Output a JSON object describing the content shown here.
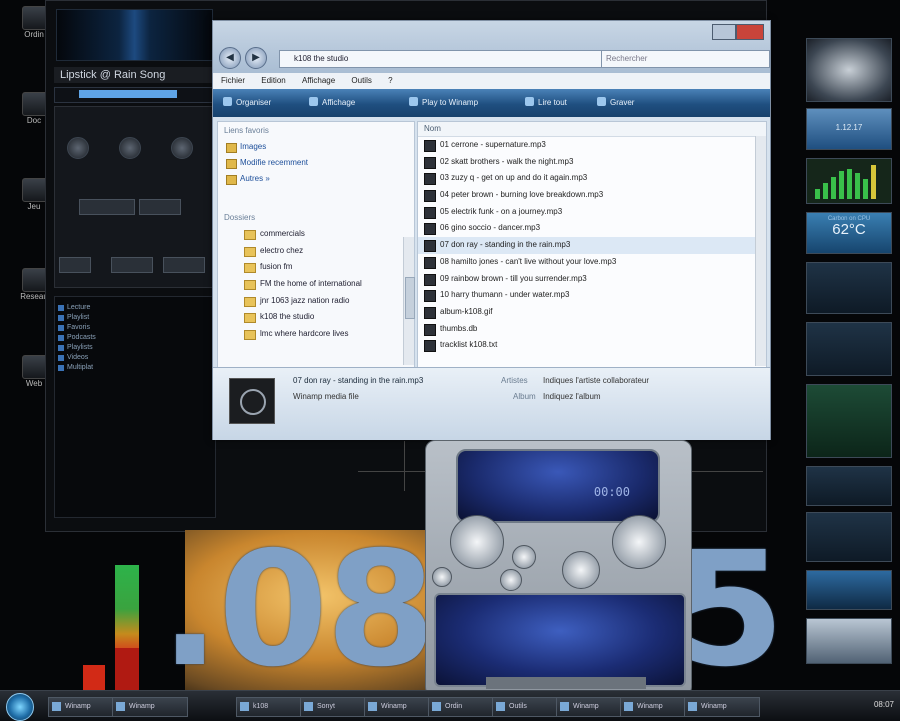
{
  "desktop": {
    "icons": [
      {
        "label": "Ordin"
      },
      {
        "label": "Doc"
      },
      {
        "label": "Jeu"
      },
      {
        "label": "Reseau"
      },
      {
        "label": "Web"
      }
    ]
  },
  "winamp": {
    "title": "Lipstick @ Rain Song",
    "seek_progress": 0.75,
    "tree_items": [
      "Lecture",
      "Playlist",
      "Favoris",
      "Podcasts",
      "Playlists",
      "Videos",
      "Multiplat"
    ]
  },
  "explorer": {
    "address": "k108 the studio",
    "search_placeholder": "Rechercher",
    "menu": [
      "Fichier",
      "Edition",
      "Affichage",
      "Outils",
      "?"
    ],
    "commands": [
      "Organiser",
      "Affichage",
      "Play to Winamp",
      "Lire tout",
      "Graver"
    ],
    "nav_header": "Liens favoris",
    "nav_links": [
      "Images",
      "Modifie recemment",
      "Autres »"
    ],
    "folders_header": "Dossiers",
    "folders": [
      "commercials",
      "electro chez",
      "fusion fm",
      "FM the home of international",
      "jnr 1063 jazz nation radio",
      "k108 the studio",
      "lmc where hardcore lives"
    ],
    "list_header": "Nom",
    "files": [
      {
        "name": "01 cerrone - supernature.mp3",
        "selected": false
      },
      {
        "name": "02 skatt brothers - walk the night.mp3",
        "selected": false
      },
      {
        "name": "03 zuzy q - get on up and do it again.mp3",
        "selected": false
      },
      {
        "name": "04 peter brown - burning love breakdown.mp3",
        "selected": false
      },
      {
        "name": "05 electrik funk - on a journey.mp3",
        "selected": false
      },
      {
        "name": "06 gino soccio - dancer.mp3",
        "selected": false
      },
      {
        "name": "07 don ray - standing in the rain.mp3",
        "selected": true
      },
      {
        "name": "08 hamilto jones - can't live without your love.mp3",
        "selected": false
      },
      {
        "name": "09 rainbow brown - till you surrender.mp3",
        "selected": false
      },
      {
        "name": "10 harry thumann - under water.mp3",
        "selected": false
      },
      {
        "name": "album-k108.gif",
        "selected": false
      },
      {
        "name": "thumbs.db",
        "selected": false
      },
      {
        "name": "tracklist k108.txt",
        "selected": false
      }
    ],
    "details": {
      "filename": "07 don ray - standing in the rain.mp3",
      "type": "Winamp media file",
      "artist_label": "Artistes",
      "artist_value": "Indiques l'artiste collaborateur",
      "album_label": "Album",
      "album_value": "Indiquez l'album"
    }
  },
  "clock": {
    "time_text": "08:0",
    "time_tail": "5",
    "dot": "."
  },
  "player": {
    "time": "00:00"
  },
  "gadgets": {
    "weather_temp": "62°C",
    "weather_label": "Carbon on CPU",
    "date": "1.12.17"
  },
  "taskbar": {
    "buttons": [
      "Winamp",
      "Winamp",
      "k108",
      "Sonyt",
      "Winamp",
      "Ordin",
      "Outils",
      "Winamp",
      "Winamp",
      "Winamp"
    ],
    "clock": "08:07"
  }
}
